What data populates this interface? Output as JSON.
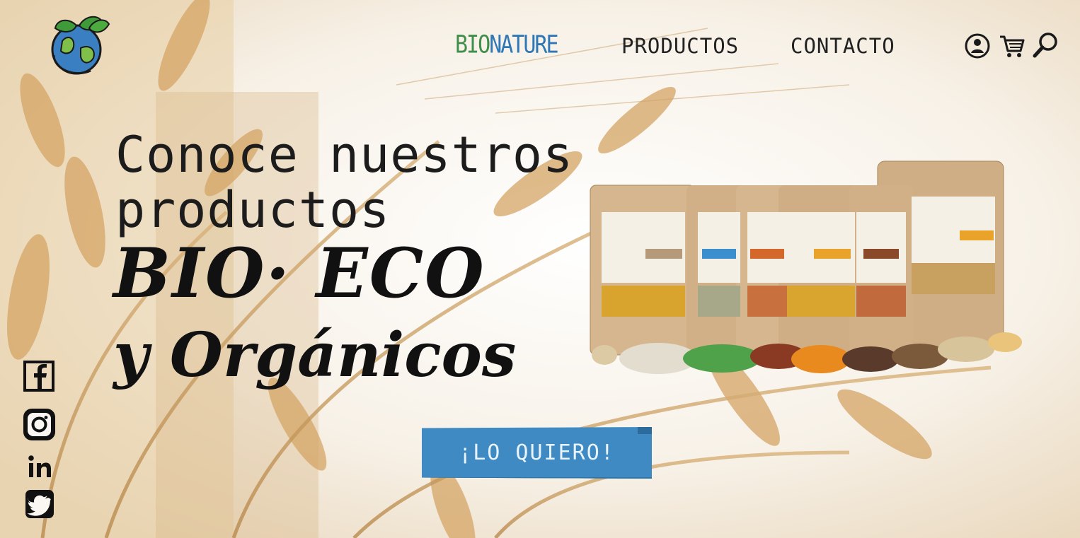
{
  "nav": {
    "brand_part1": "BIO",
    "brand_part2": "NATURE",
    "products": "PRODUCTOS",
    "contact": "CONTACTO"
  },
  "icons": {
    "logo": "earth-leaves-logo",
    "user": "user-icon",
    "cart": "cart-icon",
    "search": "search-icon"
  },
  "hero": {
    "line1": "Conoce nuestros",
    "line2": "productos",
    "line3": "BIO· ECO",
    "line4": "y Orgánicos"
  },
  "cta": {
    "label": "¡LO QUIERO!"
  },
  "social": [
    "facebook-icon",
    "instagram-icon",
    "linkedin-icon",
    "twitter-icon"
  ],
  "colors": {
    "brand_green": "#3f8f4a",
    "brand_blue": "#2f78b5",
    "cta": "#3f8ac2"
  }
}
